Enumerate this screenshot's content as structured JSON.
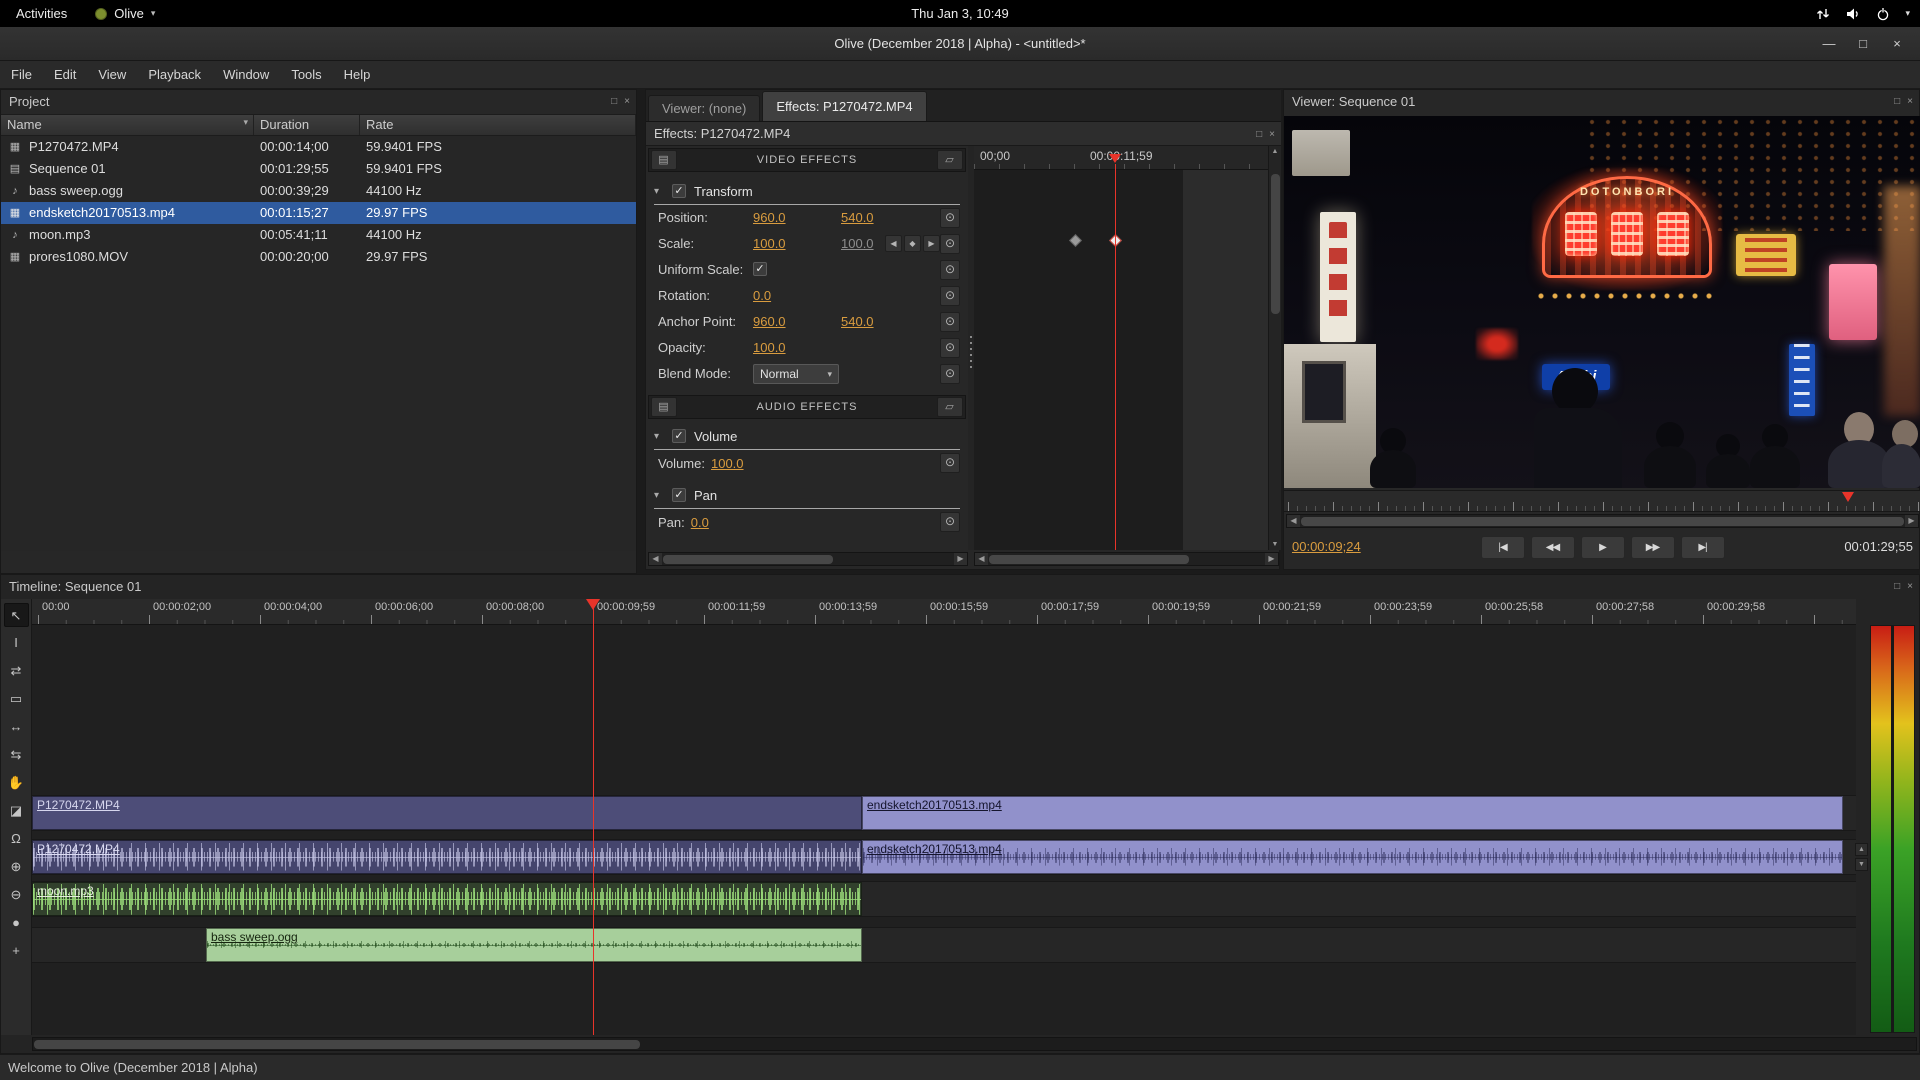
{
  "colors": {
    "accent_value": "#d99c3f",
    "selection": "#2f5b9f",
    "playhead": "#e8342a",
    "clip_video_dark": "#4d4d78",
    "clip_video_light": "#9191cb",
    "clip_audio_dark": "#45456d",
    "clip_moon": "#31402c",
    "clip_bass": "#a7cf9b"
  },
  "desktop_bar": {
    "activities": "Activities",
    "app_name": "Olive",
    "clock": "Thu Jan 3, 10:49"
  },
  "window": {
    "title": "Olive (December 2018 | Alpha) - <untitled>*"
  },
  "menu_bar": {
    "items": [
      "File",
      "Edit",
      "View",
      "Playback",
      "Window",
      "Tools",
      "Help"
    ]
  },
  "project_panel": {
    "title": "Project",
    "columns": {
      "name": "Name",
      "duration": "Duration",
      "rate": "Rate"
    },
    "rows": [
      {
        "name": "P1270472.MP4",
        "duration": "00:00:14;00",
        "rate": "59.9401 FPS"
      },
      {
        "name": "Sequence 01",
        "duration": "00:01:29;55",
        "rate": "59.9401 FPS"
      },
      {
        "name": "bass sweep.ogg",
        "duration": "00:00:39;29",
        "rate": "44100 Hz"
      },
      {
        "name": "endsketch20170513.mp4",
        "duration": "00:01:15;27",
        "rate": "29.97 FPS"
      },
      {
        "name": "moon.mp3",
        "duration": "00:05:41;11",
        "rate": "44100 Hz"
      },
      {
        "name": "prores1080.MOV",
        "duration": "00:00:20;00",
        "rate": "29.97 FPS"
      }
    ]
  },
  "effects_panel": {
    "tabs": {
      "viewer": "Viewer: (none)",
      "effects": "Effects: P1270472.MP4"
    },
    "header": "Effects: P1270472.MP4",
    "video_effects_title": "VIDEO EFFECTS",
    "audio_effects_title": "AUDIO EFFECTS",
    "transform": {
      "title": "Transform",
      "rows": [
        {
          "label": "Position:",
          "value1": "960.0",
          "value2": "540.0"
        },
        {
          "label": "Scale:",
          "value1": "100.0",
          "value2": "100.0"
        },
        {
          "label": "Uniform Scale:"
        },
        {
          "label": "Rotation:",
          "value1": "0.0"
        },
        {
          "label": "Anchor Point:",
          "value1": "960.0",
          "value2": "540.0"
        },
        {
          "label": "Opacity:",
          "value1": "100.0"
        },
        {
          "label": "Blend Mode:",
          "value1": "Normal"
        }
      ]
    },
    "volume": {
      "title": "Volume",
      "label": "Volume:",
      "value": "100.0"
    },
    "pan": {
      "title": "Pan",
      "label": "Pan:",
      "value": "0.0"
    },
    "keyframes": {
      "ruler_start": "00;00",
      "ruler_playhead": "00:00:11;59"
    }
  },
  "viewer_panel": {
    "title": "Viewer: Sequence 01",
    "current_time": "00:00:09;24",
    "duration": "00:01:29;55",
    "sign_text": "DOTONBORI",
    "sign_text2": "Asahi"
  },
  "timeline_panel": {
    "title": "Timeline: Sequence 01",
    "ruler_labels": [
      "00:00",
      "00:00:02;00",
      "00:00:04;00",
      "00:00:06;00",
      "00:00:08;00",
      "00:00:09;59",
      "00:00:11;59",
      "00:00:13;59",
      "00:00:15;59",
      "00:00:17;59",
      "00:00:19;59",
      "00:00:21;59",
      "00:00:23;59",
      "00:00:25;58",
      "00:00:27;58",
      "00:00:29;58"
    ],
    "clips": {
      "video_a": "P1270472.MP4",
      "video_b": "endsketch20170513.mp4",
      "audio_a": "P1270472.MP4",
      "audio_b": "endsketch20170513.mp4",
      "audio_c": "moon.mp3",
      "audio_d": "bass sweep.ogg"
    }
  },
  "status_bar": {
    "message": "Welcome to Olive (December 2018 | Alpha)"
  },
  "icons": {
    "app_menu_chevron": "▾",
    "window_minimize": "—",
    "window_maximize": "□",
    "window_close": "×",
    "panel_popout": "□",
    "panel_close": "×",
    "sort_arrow": "▾",
    "section_arrow": "▾",
    "check": "✓",
    "keyframe_clock": "⊙",
    "kf_prev": "◀",
    "kf_add": "◆",
    "kf_next": "▶",
    "dropdown": "▾",
    "scroll_left": "◀",
    "scroll_right": "▶",
    "scroll_up": "▲",
    "scroll_down": "▼",
    "transport": [
      "|◀",
      "◀◀",
      "▶",
      "▶▶",
      "▶|"
    ],
    "tools": [
      "↖",
      "I",
      "⇄",
      "▭",
      "↔",
      "⇆",
      "✋",
      "◪",
      "Ω",
      "⊕",
      "⊖",
      "●",
      "+"
    ],
    "media_video": "▦",
    "media_sequence": "▤",
    "media_audio": "♪",
    "effects_stack": "▤",
    "effects_folder": "▱"
  }
}
